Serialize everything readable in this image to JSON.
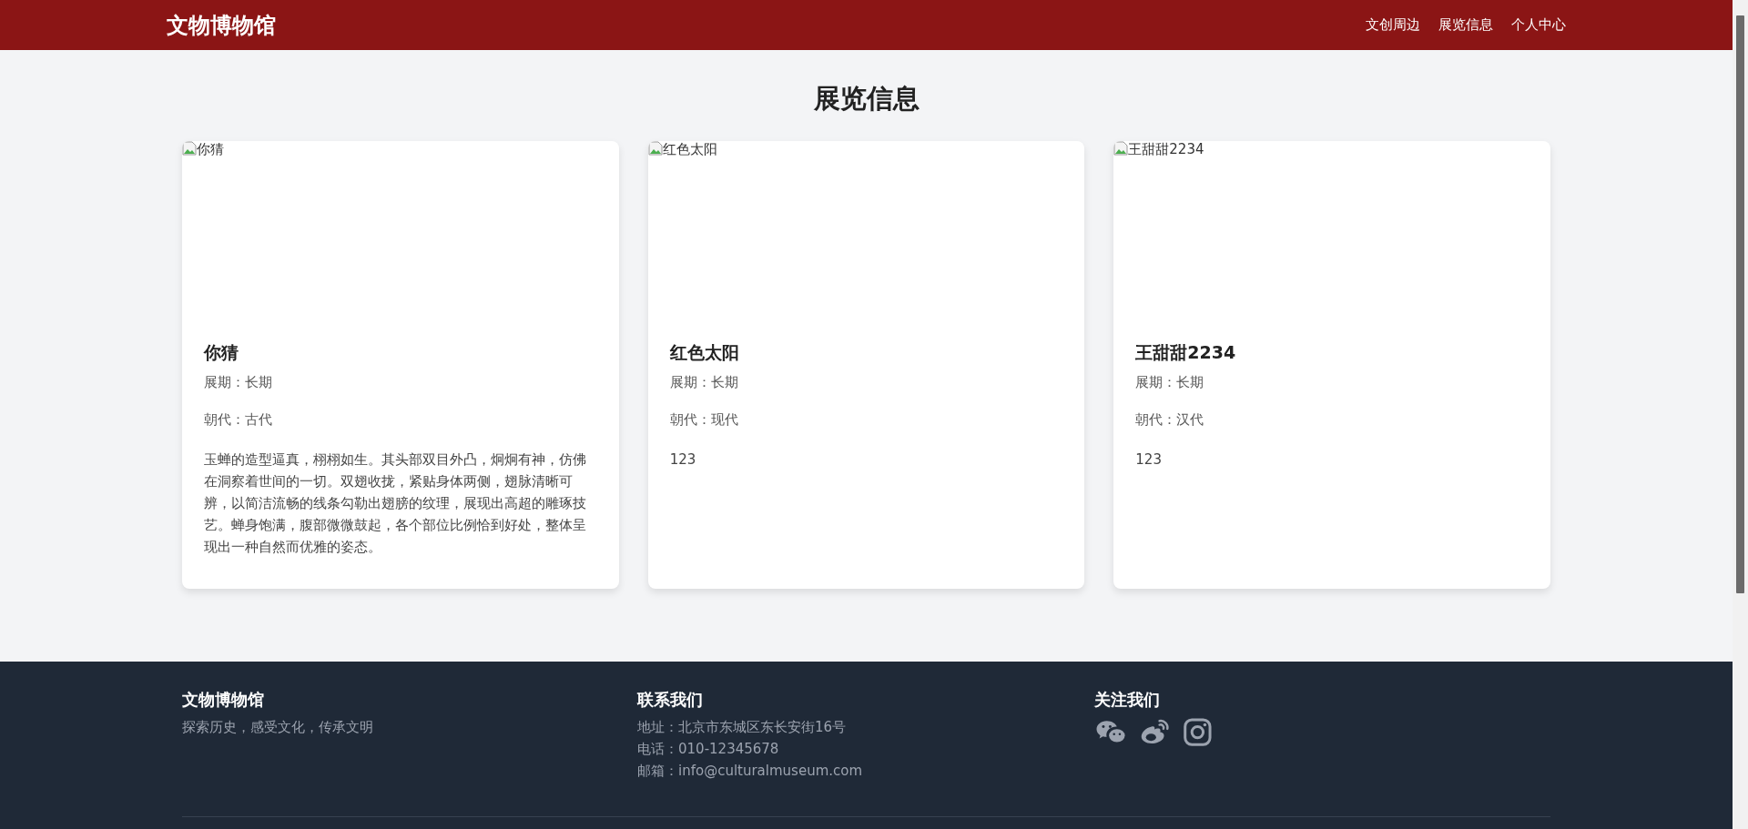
{
  "header": {
    "logo": "文物博物馆",
    "nav": [
      {
        "label": "文创周边",
        "selected": false
      },
      {
        "label": "展览信息",
        "selected": false
      },
      {
        "label": "个人中心",
        "selected": false
      }
    ]
  },
  "page_title": "展览信息",
  "exhibitions": [
    {
      "image_alt": "你猜",
      "title": "你猜",
      "period": "展期：长期",
      "dynasty": "朝代：古代",
      "description": "玉蝉的造型逼真，栩栩如生。其头部双目外凸，炯炯有神，仿佛在洞察着世间的一切。双翅收拢，紧贴身体两侧，翅脉清晰可辨，以简洁流畅的线条勾勒出翅膀的纹理，展现出高超的雕琢技艺。蝉身饱满，腹部微微鼓起，各个部位比例恰到好处，整体呈现出一种自然而优雅的姿态。"
    },
    {
      "image_alt": "红色太阳",
      "title": "红色太阳",
      "period": "展期：长期",
      "dynasty": "朝代：现代",
      "description": "123"
    },
    {
      "image_alt": "王甜甜2234",
      "title": "王甜甜2234",
      "period": "展期：长期",
      "dynasty": "朝代：汉代",
      "description": "123"
    }
  ],
  "footer": {
    "about": {
      "title": "文物博物馆",
      "text": "探索历史，感受文化，传承文明"
    },
    "contact": {
      "title": "联系我们",
      "lines": [
        "地址：北京市东城区东长安街16号",
        "电话：010-12345678",
        "邮箱：info@culturalmuseum.com"
      ]
    },
    "follow": {
      "title": "关注我们",
      "icons": [
        {
          "kind": "wechat"
        },
        {
          "kind": "weibo"
        },
        {
          "kind": "instagram"
        }
      ]
    }
  }
}
